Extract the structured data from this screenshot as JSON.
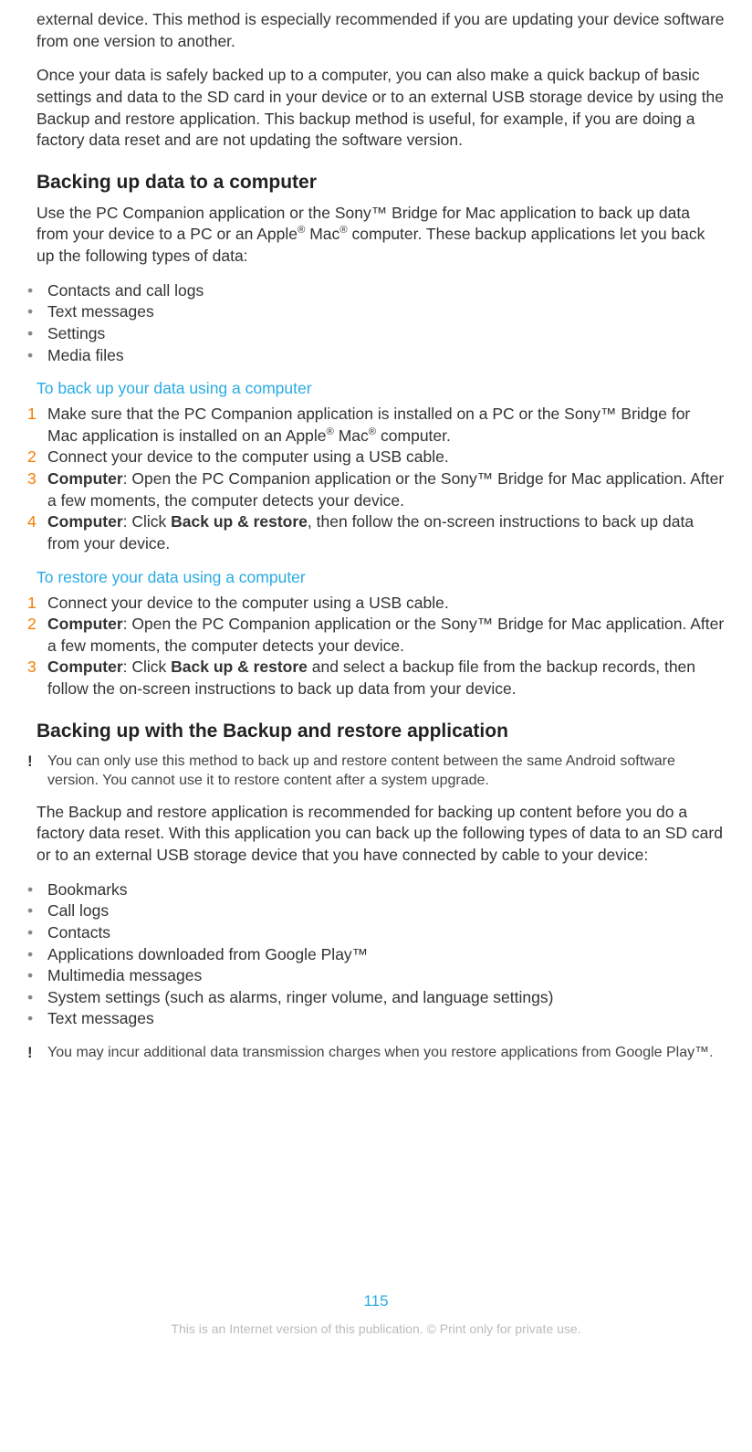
{
  "intro": {
    "p1": "external device. This method is especially recommended if you are updating your device software from one version to another.",
    "p2": "Once your data is safely backed up to a computer, you can also make a quick backup of basic settings and data to the SD card in your device or to an external USB storage device by using the Backup and restore application. This backup method is useful, for example, if you are doing a factory data reset and are not updating the software version."
  },
  "sec1": {
    "title": "Backing up data to a computer",
    "p_html": "Use the PC Companion application or the Sony™ Bridge for Mac application to back up data from your device to a PC or an Apple<sup>®</sup> Mac<sup>®</sup> computer. These backup applications let you back up the following types of data:",
    "bullets": [
      "Contacts and call logs",
      "Text messages",
      "Settings",
      "Media files"
    ],
    "sub1": {
      "title": "To back up your data using a computer",
      "items_html": [
        "Make sure that the PC Companion application is installed on a PC or the Sony™ Bridge for Mac application is installed on an Apple<sup>®</sup> Mac<sup>®</sup> computer.",
        "Connect your device to the computer using a USB cable.",
        "<span class='bold'>Computer</span>: Open the PC Companion application or the Sony™ Bridge for Mac application. After a few moments, the computer detects your device.",
        "<span class='bold'>Computer</span>: Click <span class='bold'>Back up & restore</span>, then follow the on-screen instructions to back up data from your device."
      ]
    },
    "sub2": {
      "title": "To restore your data using a computer",
      "items_html": [
        "Connect your device to the computer using a USB cable.",
        "<span class='bold'>Computer</span>: Open the PC Companion application or the Sony™ Bridge for Mac application. After a few moments, the computer detects your device.",
        "<span class='bold'>Computer</span>: Click <span class='bold'>Back up & restore</span> and select a backup file from the backup records, then follow the on-screen instructions to back up data from your device."
      ]
    }
  },
  "sec2": {
    "title": "Backing up with the Backup and restore application",
    "note1": "You can only use this method to back up and restore content between the same Android software version. You cannot use it to restore content after a system upgrade.",
    "p": "The Backup and restore application is recommended for backing up content before you do a factory data reset. With this application you can back up the following types of data to an SD card or to an external USB storage device that you have connected by cable to your device:",
    "bullets": [
      "Bookmarks",
      "Call logs",
      "Contacts",
      "Applications downloaded from Google Play™",
      "Multimedia messages",
      "System settings (such as alarms, ringer volume, and language settings)",
      "Text messages"
    ],
    "note2": "You may incur additional data transmission charges when you restore applications from Google Play™."
  },
  "page_number": "115",
  "footer": "This is an Internet version of this publication. © Print only for private use."
}
